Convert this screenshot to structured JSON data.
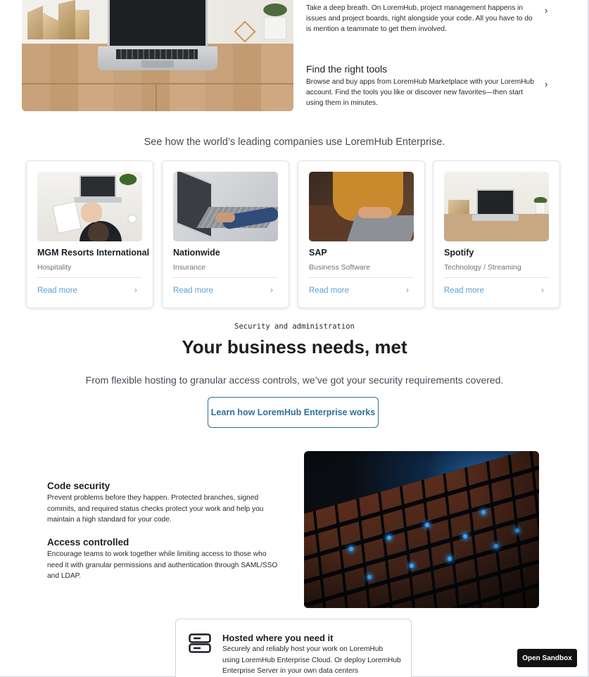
{
  "features": [
    {
      "title": "",
      "body": "Take a deep breath. On LoremHub, project management happens in issues and project boards, right alongside your code. All you have to do is mention a teammate to get them involved."
    },
    {
      "title": "Find the right tools",
      "body": "Browse and buy apps from LoremHub Marketplace with your LoremHub account. Find the tools you like or discover new favorites—then start using them in minutes."
    }
  ],
  "chevron": "›",
  "companies_lead": "See how the world’s leading companies use LoremHub Enterprise.",
  "companies": [
    {
      "name": "MGM Resorts International",
      "sector": "Hospitality",
      "link": "Read more"
    },
    {
      "name": "Nationwide",
      "sector": "Insurance",
      "link": "Read more"
    },
    {
      "name": "SAP",
      "sector": "Business Software",
      "link": "Read more"
    },
    {
      "name": "Spotify",
      "sector": "Technology / Streaming",
      "link": "Read more"
    }
  ],
  "security": {
    "eyebrow": "Security and administration",
    "title": "Your business needs, met",
    "lead": "From flexible hosting to granular access controls, we’ve got your security requirements covered.",
    "cta": "Learn how LoremHub Enterprise works",
    "items": [
      {
        "title": "Code security",
        "body": "Prevent problems before they happen. Protected branches, signed commits, and required status checks protect your work and help you maintain a high standard for your code."
      },
      {
        "title": "Access controlled",
        "body": "Encourage teams to work together while limiting access to those who need it with granular permissions and authentication through SAML/SSO and LDAP."
      }
    ]
  },
  "hosted": {
    "title": "Hosted where you need it",
    "body": "Securely and reliably host your work on LoremHub using LoremHub Enterprise Cloud. Or deploy LoremHub Enterprise Server in your own data centers"
  },
  "sandbox_button": "Open Sandbox",
  "colors": {
    "link": "#5ea1d6",
    "cta_border": "#2f6f9f",
    "sandbox_bg": "#121212"
  },
  "icons": {
    "hosted": "server-icon",
    "card_link": "chevron-right-icon"
  }
}
